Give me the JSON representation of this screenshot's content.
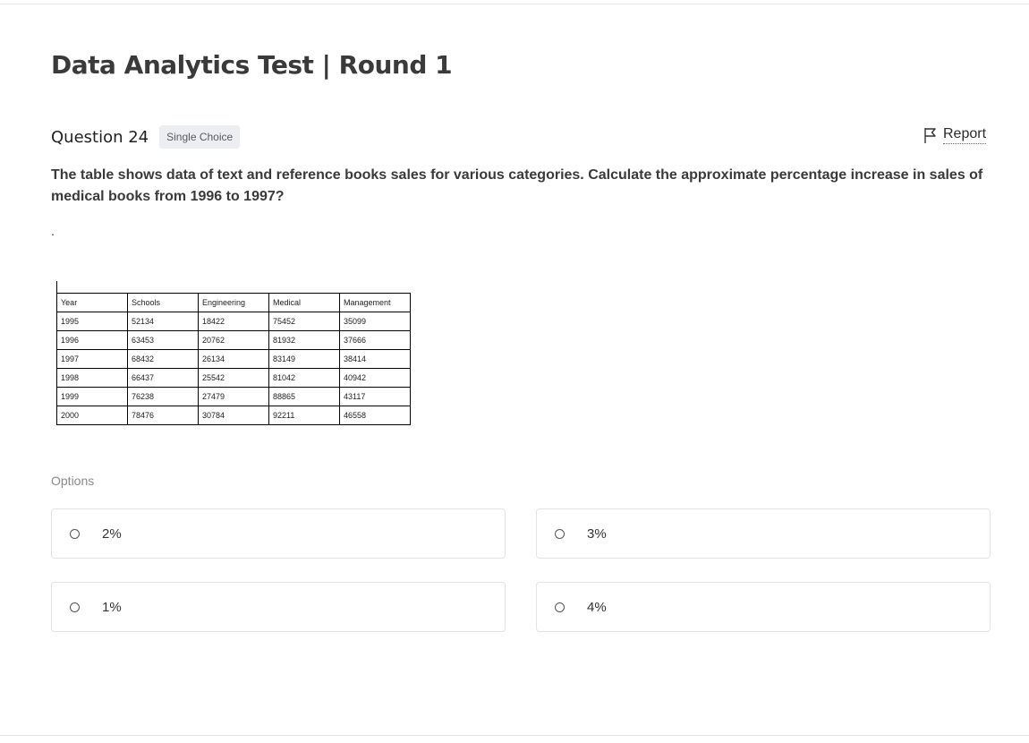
{
  "page": {
    "title": "Data Analytics Test | Round 1"
  },
  "question": {
    "label": "Question 24",
    "type_badge": "Single Choice",
    "report_label": "Report",
    "text": "The table shows data of text and reference books sales for various categories. Calculate the approximate percentage increase in sales of medical books from 1996 to 1997?",
    "note": "."
  },
  "table": {
    "headers": [
      "Year",
      "Schools",
      "Engineering",
      "Medical",
      "Management"
    ],
    "rows": [
      [
        "1995",
        "52134",
        "18422",
        "75452",
        "35099"
      ],
      [
        "1996",
        "63453",
        "20762",
        "81932",
        "37666"
      ],
      [
        "1997",
        "68432",
        "26134",
        "83149",
        "38414"
      ],
      [
        "1998",
        "66437",
        "25542",
        "81042",
        "40942"
      ],
      [
        "1999",
        "76238",
        "27479",
        "88865",
        "43117"
      ],
      [
        "2000",
        "78476",
        "30784",
        "92211",
        "46558"
      ]
    ]
  },
  "options": {
    "label": "Options",
    "items": [
      "2%",
      "3%",
      "1%",
      "4%"
    ]
  },
  "icons": {
    "report": "flag-icon",
    "option_marker": "radio-circle"
  }
}
